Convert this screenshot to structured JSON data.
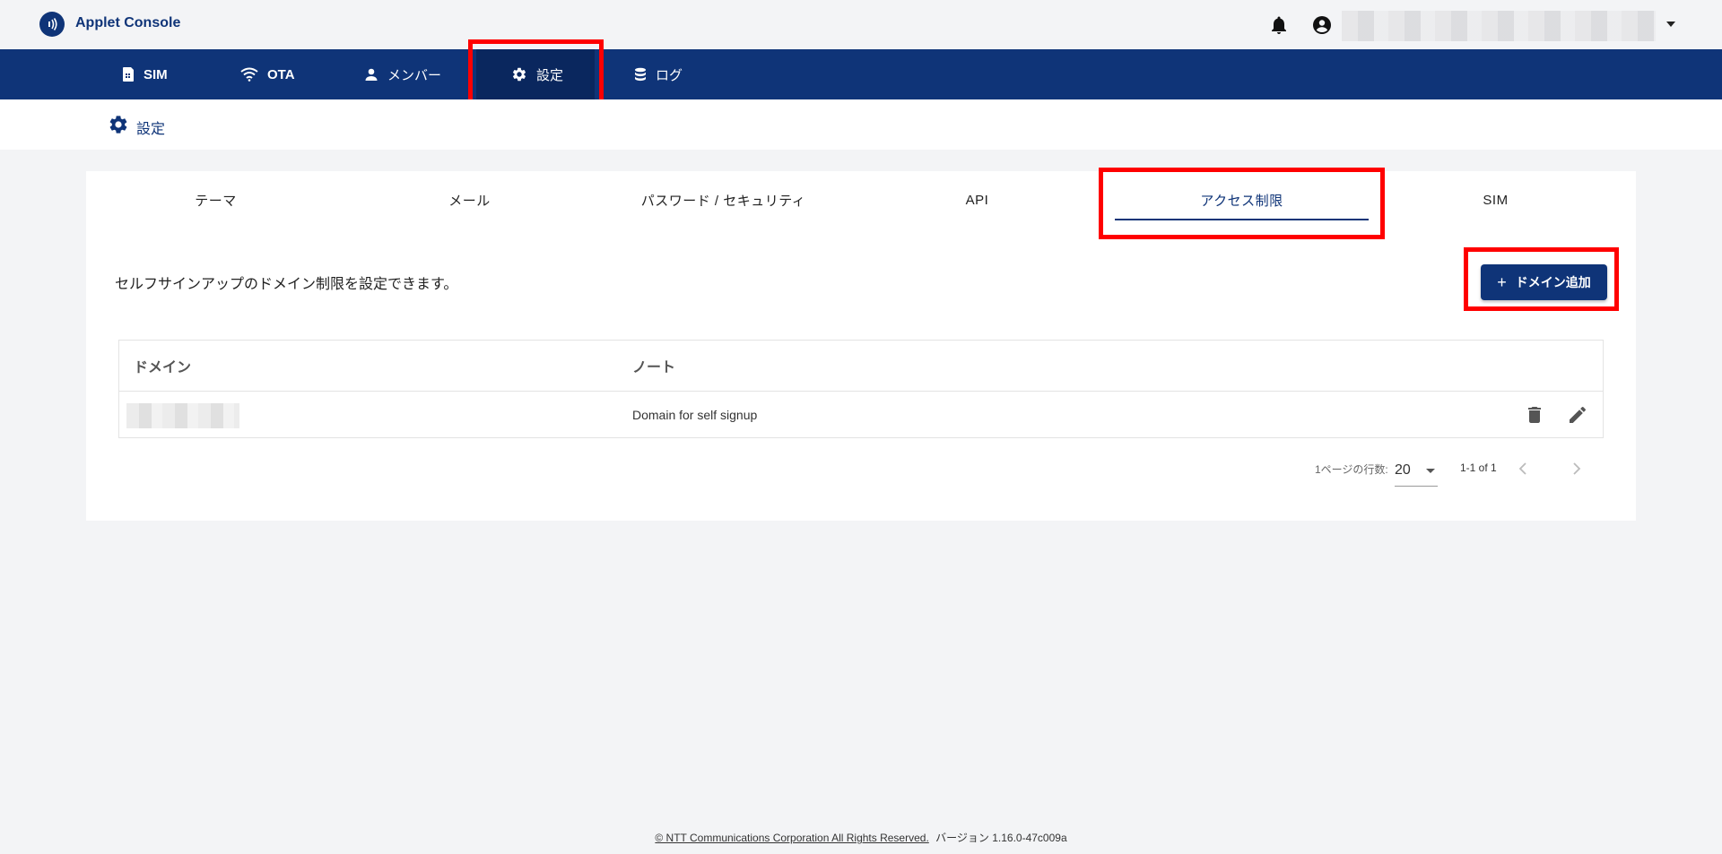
{
  "app": {
    "title": "Applet Console"
  },
  "colors": {
    "primary": "#0f3478",
    "highlight": "#ff0000",
    "background": "#f3f4f6"
  },
  "nav": {
    "items": [
      {
        "label": "SIM",
        "icon": "sim-card-icon"
      },
      {
        "label": "OTA",
        "icon": "wifi-icon"
      },
      {
        "label": "メンバー",
        "icon": "person-icon"
      },
      {
        "label": "設定",
        "icon": "gear-icon",
        "active": true
      },
      {
        "label": "ログ",
        "icon": "database-icon"
      }
    ]
  },
  "breadcrumb": {
    "label": "設定",
    "icon": "gear-icon"
  },
  "tabs": [
    {
      "label": "テーマ"
    },
    {
      "label": "メール"
    },
    {
      "label": "パスワード / セキュリティ"
    },
    {
      "label": "API"
    },
    {
      "label": "アクセス制限",
      "active": true
    },
    {
      "label": "SIM"
    }
  ],
  "access": {
    "description": "セルフサインアップのドメイン制限を設定できます。",
    "add_button_label": "ドメイン追加"
  },
  "table": {
    "headers": {
      "domain": "ドメイン",
      "note": "ノート"
    },
    "rows": [
      {
        "note": "Domain for self signup"
      }
    ]
  },
  "pagination": {
    "rows_per_page_label": "1ページの行数:",
    "rows_per_page": "20",
    "range": "1-1 of 1"
  },
  "footer": {
    "copyright": "© NTT Communications Corporation All Rights Reserved.",
    "version": "バージョン 1.16.0-47c009a"
  }
}
